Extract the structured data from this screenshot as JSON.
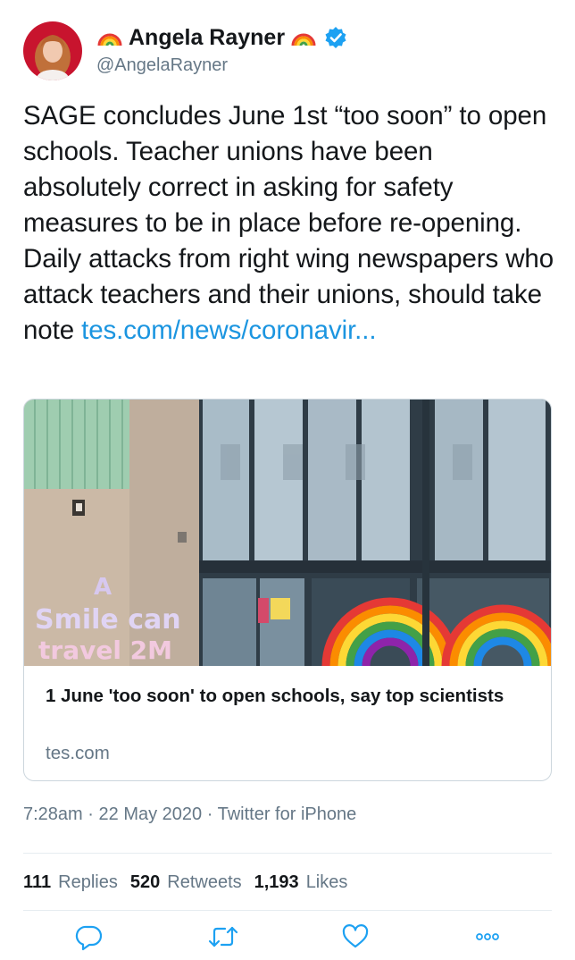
{
  "author": {
    "display_name": "Angela Rayner",
    "handle": "@AngelaRayner",
    "verified": true
  },
  "tweet": {
    "text": "SAGE concludes June 1st “too soon” to open schools. Teacher unions have been absolutely correct in asking for safety measures to be in place before re-opening. Daily attacks from right wing newspapers who attack teachers and their unions, should take note",
    "link_text": "tes.com/news/coronavir..."
  },
  "card": {
    "title": "1 June 'too soon' to open schools, say top scientists",
    "domain": "tes.com",
    "image_text": "A Smile can travel 2M"
  },
  "meta": {
    "time": "7:28am",
    "date": "22 May 2020",
    "source": "Twitter for iPhone",
    "separator": "·"
  },
  "stats": {
    "replies_count": "111",
    "replies_label": "Replies",
    "retweets_count": "520",
    "retweets_label": "Retweets",
    "likes_count": "1,193",
    "likes_label": "Likes"
  },
  "colors": {
    "link": "#1b95e0",
    "secondary_text": "#657786",
    "verified": "#1da1f2",
    "border": "#ccd6dd",
    "action_icon": "#1da1f2"
  },
  "actions": {
    "reply_icon": "reply-icon",
    "retweet_icon": "retweet-icon",
    "like_icon": "like-icon",
    "more_icon": "more-icon"
  }
}
